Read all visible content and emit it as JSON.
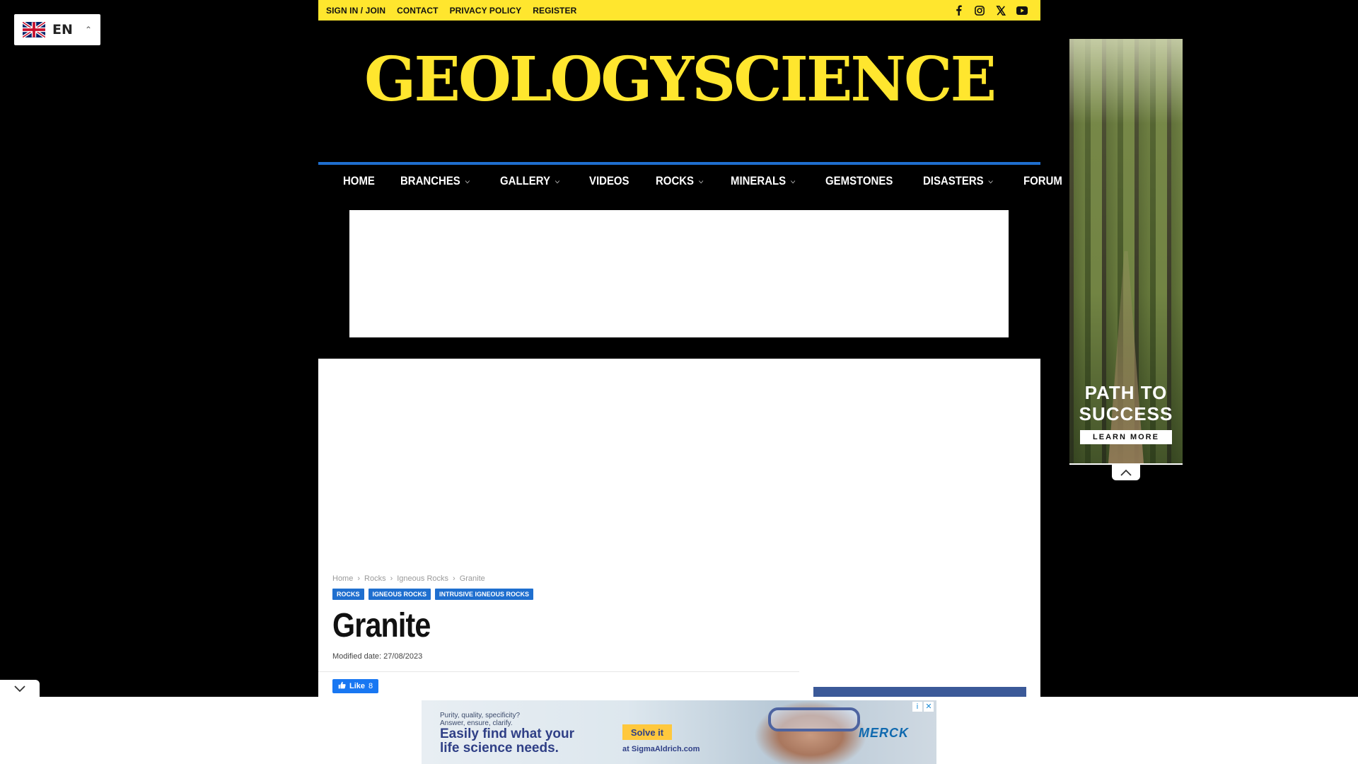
{
  "language": {
    "code": "EN"
  },
  "topbar": {
    "links": [
      "SIGN IN / JOIN",
      "CONTACT",
      "PRIVACY POLICY",
      "REGISTER"
    ],
    "social": [
      "facebook-icon",
      "instagram-icon",
      "x-icon",
      "youtube-icon"
    ]
  },
  "logo": {
    "text": "GEOLOGYSCIENCE"
  },
  "nav": {
    "items": [
      {
        "label": "HOME",
        "dropdown": false
      },
      {
        "label": "BRANCHES",
        "dropdown": true
      },
      {
        "label": "GALLERY",
        "dropdown": true
      },
      {
        "label": "VIDEOS",
        "dropdown": false
      },
      {
        "label": "ROCKS",
        "dropdown": true
      },
      {
        "label": "MINERALS",
        "dropdown": true
      },
      {
        "label": "GEMSTONES",
        "dropdown": false
      },
      {
        "label": "DISASTERS",
        "dropdown": true
      },
      {
        "label": "FORUM",
        "dropdown": false
      }
    ]
  },
  "breadcrumb": [
    "Home",
    "Rocks",
    "Igneous Rocks",
    "Granite"
  ],
  "categories": [
    "ROCKS",
    "IGNEOUS ROCKS",
    "INTRUSIVE IGNEOUS ROCKS"
  ],
  "article": {
    "title": "Granite",
    "modified": "Modified date: 27/08/2023"
  },
  "fb_like": {
    "label": "Like",
    "count": "8"
  },
  "side_ad": {
    "headline": "PATH TO SUCCESS",
    "cta": "LEARN MORE"
  },
  "bottom_ad": {
    "tagline": "Purity, quality, specificity?\nAnswer, ensure, clarify.",
    "headline": "Easily find what your\nlife science needs.",
    "button": "Solve it",
    "site": "at SigmaAldrich.com",
    "brand": "MERCK"
  },
  "colors": {
    "accent": "#ffe62e",
    "nav_border": "#1f6fcf",
    "category": "#1f6fcf"
  }
}
